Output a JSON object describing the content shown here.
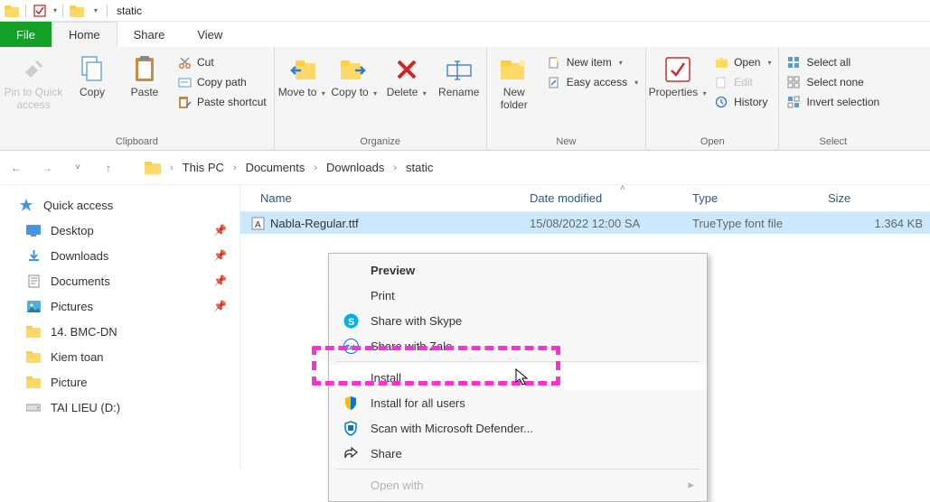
{
  "title": "static",
  "tabs": {
    "file": "File",
    "home": "Home",
    "share": "Share",
    "view": "View"
  },
  "ribbon": {
    "clipboard": {
      "label": "Clipboard",
      "pin_to_quick": "Pin to Quick access",
      "copy": "Copy",
      "paste": "Paste",
      "cut": "Cut",
      "copy_path": "Copy path",
      "paste_shortcut": "Paste shortcut"
    },
    "organize": {
      "label": "Organize",
      "move_to": "Move to",
      "copy_to": "Copy to",
      "delete": "Delete",
      "rename": "Rename"
    },
    "new": {
      "label": "New",
      "new_folder": "New folder",
      "new_item": "New item",
      "easy_access": "Easy access"
    },
    "open": {
      "label": "Open",
      "properties": "Properties",
      "open": "Open",
      "edit": "Edit",
      "history": "History"
    },
    "select": {
      "label": "Select",
      "select_all": "Select all",
      "select_none": "Select none",
      "invert": "Invert selection"
    }
  },
  "breadcrumb": [
    "This PC",
    "Documents",
    "Downloads",
    "static"
  ],
  "sidebar": {
    "quick": "Quick access",
    "items": [
      {
        "label": "Desktop",
        "pinned": true
      },
      {
        "label": "Downloads",
        "pinned": true
      },
      {
        "label": "Documents",
        "pinned": true
      },
      {
        "label": "Pictures",
        "pinned": true
      },
      {
        "label": "14. BMC-DN",
        "pinned": false
      },
      {
        "label": "Kiem toan",
        "pinned": false
      },
      {
        "label": "Picture",
        "pinned": false
      },
      {
        "label": "TAI LIEU (D:)",
        "pinned": false
      }
    ]
  },
  "columns": {
    "name": "Name",
    "date": "Date modified",
    "type": "Type",
    "size": "Size"
  },
  "file_row": {
    "name": "Nabla-Regular.ttf",
    "date": "15/08/2022 12:00 SA",
    "type": "TrueType font file",
    "size": "1.364 KB"
  },
  "context_menu": {
    "preview": "Preview",
    "print": "Print",
    "share_skype": "Share with Skype",
    "share_zalo": "Share with Zalo",
    "install": "Install",
    "install_all": "Install for all users",
    "scan": "Scan with Microsoft Defender...",
    "share": "Share",
    "open_with": "Open with"
  }
}
